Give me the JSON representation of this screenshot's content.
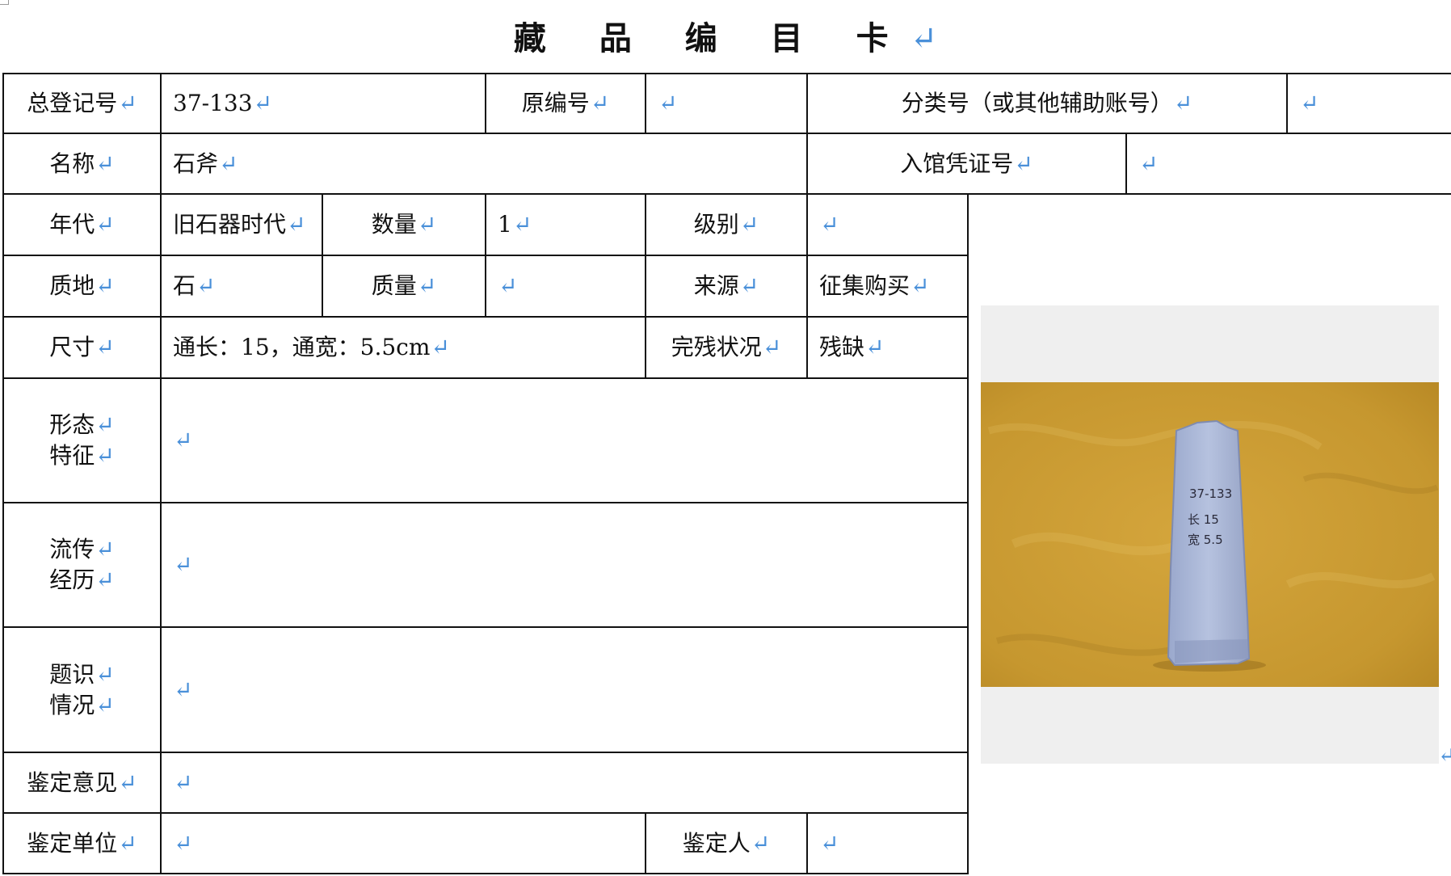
{
  "title": "藏 品 编 目 卡",
  "return_mark": "↵",
  "rows": {
    "registry_label": "总登记号",
    "registry_value": "37-133",
    "original_no_label": "原编号",
    "original_no_value": "",
    "classification_label": "分类号（或其他辅助账号）",
    "classification_value": "",
    "name_label": "名称",
    "name_value": "石斧",
    "voucher_label": "入馆凭证号",
    "voucher_value": "",
    "era_label": "年代",
    "era_value": "旧石器时代",
    "quantity_label": "数量",
    "quantity_value": "1",
    "grade_label": "级别",
    "grade_value": "",
    "material_label": "质地",
    "material_value": "石",
    "mass_label": "质量",
    "mass_value": "",
    "source_label": "来源",
    "source_value": "征集购买",
    "size_label": "尺寸",
    "size_value": "通长：15，通宽：5.5cm",
    "condition_label": "完残状况",
    "condition_value": "残缺",
    "form_label_1": "形态",
    "form_label_2": "特征",
    "form_value": "",
    "provenance_label_1": "流传",
    "provenance_label_2": "经历",
    "provenance_value": "",
    "inscription_label_1": "题识",
    "inscription_label_2": "情况",
    "inscription_value": "",
    "opinion_label": "鉴定意见",
    "opinion_value": "",
    "unit_label": "鉴定单位",
    "unit_value": "",
    "appraiser_label": "鉴定人",
    "appraiser_value": ""
  },
  "photo": {
    "inscription_line_1": "37-133",
    "inscription_line_2": "长 15",
    "inscription_line_3": "宽 5.5",
    "background_color": "#c99a33",
    "object_color": "#a9b6d6"
  }
}
